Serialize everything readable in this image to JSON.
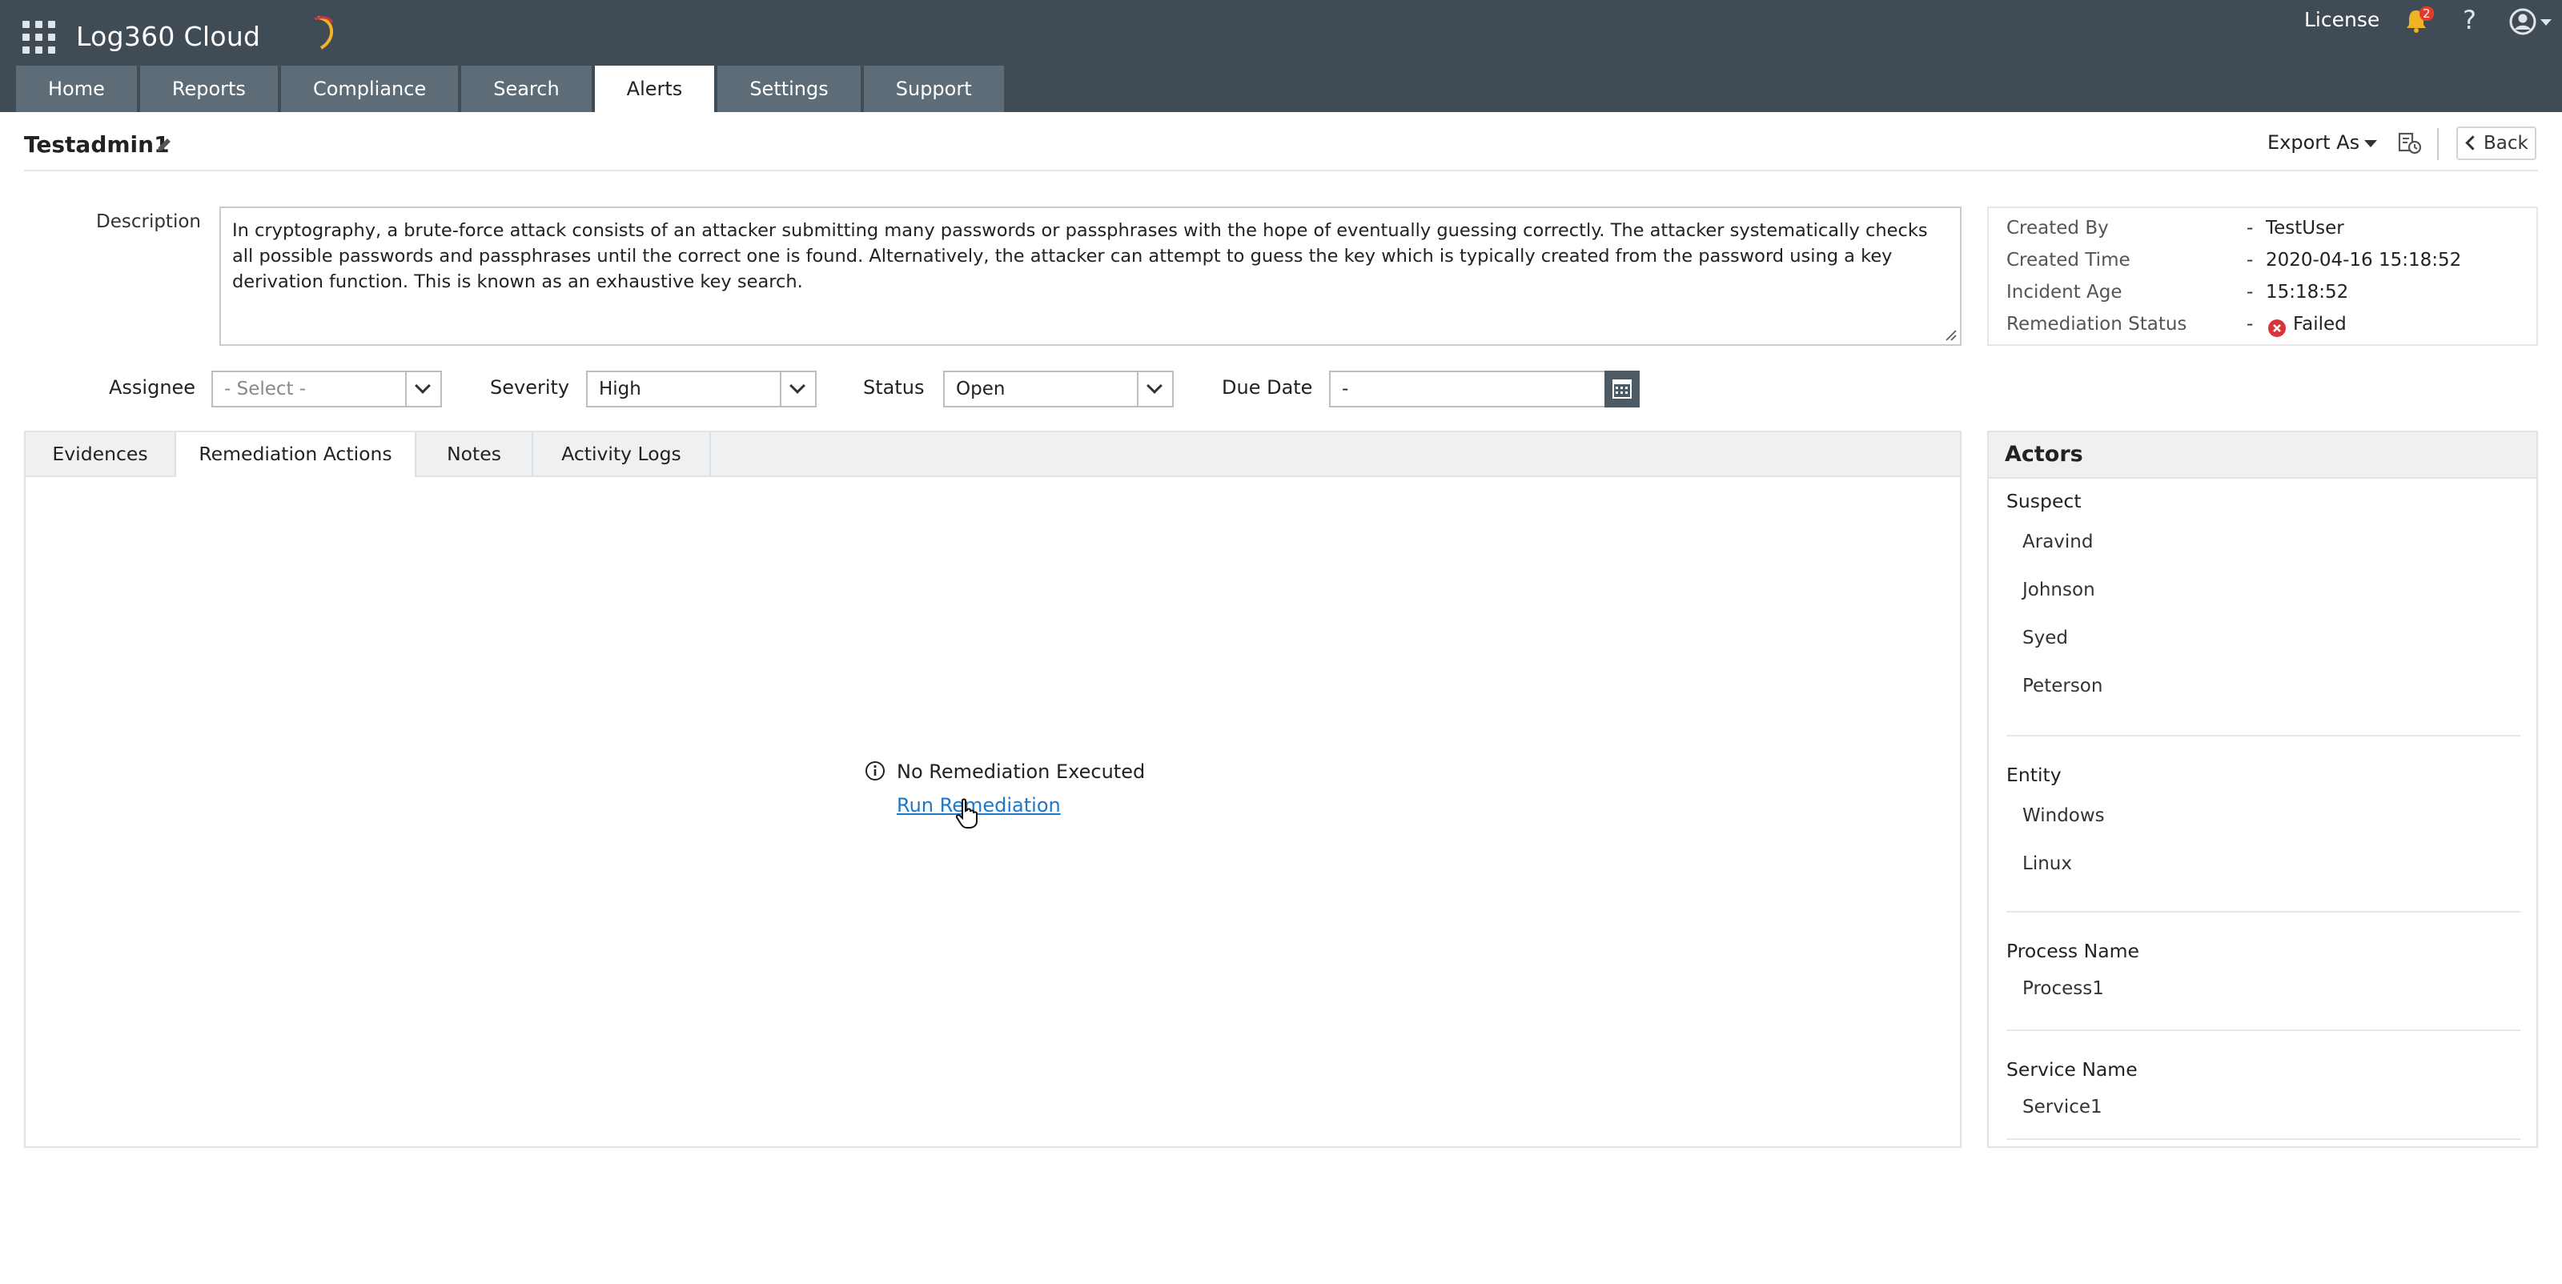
{
  "header": {
    "app_name": "Log360 Cloud",
    "license_label": "License",
    "notifications_count": "2",
    "help_label": "?",
    "tabs": [
      {
        "label": "Home",
        "active": false
      },
      {
        "label": "Reports",
        "active": false
      },
      {
        "label": "Compliance",
        "active": false
      },
      {
        "label": "Search",
        "active": false
      },
      {
        "label": "Alerts",
        "active": true
      },
      {
        "label": "Settings",
        "active": false
      },
      {
        "label": "Support",
        "active": false
      }
    ]
  },
  "incident": {
    "title": "Testadmin1",
    "export_label": "Export As",
    "back_label": "Back",
    "description_label": "Description",
    "description": "In cryptography, a brute-force attack consists of an attacker submitting many passwords or passphrases with the hope of eventually guessing correctly. The attacker systematically checks all possible passwords and passphrases until the correct one is found. Alternatively, the attacker can attempt to guess the key which is typically created from the password using a key derivation function. This is known as an exhaustive key search.",
    "meta": [
      {
        "label": "Created By",
        "value": "TestUser"
      },
      {
        "label": "Created Time",
        "value": "2020-04-16 15:18:52"
      },
      {
        "label": "Incident Age",
        "value": "15:18:52"
      },
      {
        "label": "Remediation Status",
        "value": "Failed"
      }
    ],
    "meta_separator": "-"
  },
  "filters": {
    "assignee_label": "Assignee",
    "assignee_value": "- Select -",
    "severity_label": "Severity",
    "severity_value": "High",
    "status_label": "Status",
    "status_value": "Open",
    "due_date_label": "Due Date",
    "due_date_value": "-"
  },
  "panel": {
    "tabs": [
      {
        "label": "Evidences",
        "active": false
      },
      {
        "label": "Remediation Actions",
        "active": true
      },
      {
        "label": "Notes",
        "active": false
      },
      {
        "label": "Activity Logs",
        "active": false
      }
    ],
    "empty_message": "No Remediation Executed",
    "run_link": "Run Remediation"
  },
  "actors": {
    "title": "Actors",
    "groups": [
      {
        "title": "Suspect",
        "items": [
          "Aravind",
          "Johnson",
          "Syed",
          "Peterson"
        ]
      },
      {
        "title": "Entity",
        "items": [
          "Windows",
          "Linux"
        ]
      },
      {
        "title": "Process Name",
        "items": [
          "Process1"
        ]
      },
      {
        "title": "Service Name",
        "items": [
          "Service1"
        ]
      }
    ]
  },
  "colors": {
    "header_bg": "#3f4b55",
    "tab_bg": "#5e6c77",
    "link": "#1d78c7",
    "failed": "#d9343a",
    "bell": "#f0b323"
  }
}
